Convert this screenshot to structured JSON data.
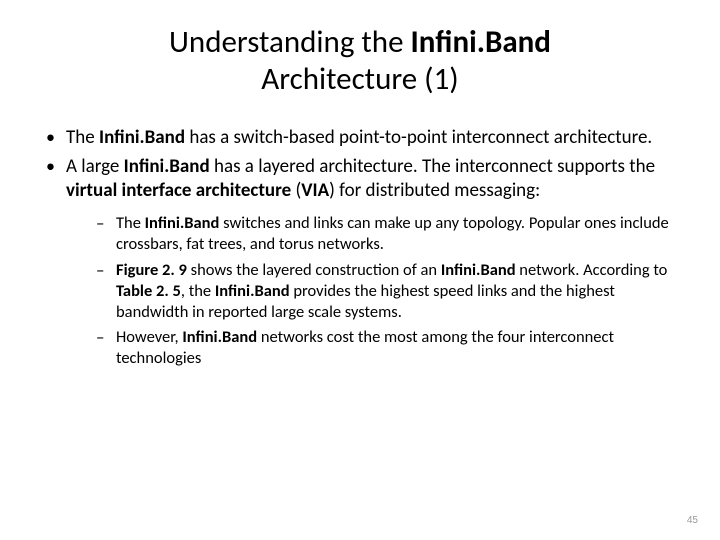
{
  "title": {
    "prefix": "Understanding the ",
    "bold": "Infini.Band",
    "line2": "Architecture (1)"
  },
  "bullets": {
    "b1": {
      "p1": "The ",
      "p2": "Infini.Band ",
      "p3": "has a switch-based point-to-point interconnect architecture."
    },
    "b2": {
      "p1": "A large ",
      "p2": "Infini.Band ",
      "p3": "has a layered architecture.  The interconnect supports the ",
      "p4": "virtual interface architecture ",
      "p5": "(",
      "p6": "VIA",
      "p7": ") for distributed messaging:"
    }
  },
  "subs": {
    "s1": {
      "p1": "The ",
      "p2": "Infini.Band ",
      "p3": "switches and links can make up any topology. Popular ones include crossbars, fat trees, and torus networks."
    },
    "s2": {
      "p1": "Figure 2. 9 ",
      "p2": "shows the layered construction of an ",
      "p3": "Infini.Band ",
      "p4": "network. According to ",
      "p5": "Table 2. 5",
      "p6": ", the ",
      "p7": "Infini.Band ",
      "p8": "provides the highest speed links and the highest bandwidth in reported large scale systems."
    },
    "s3": {
      "p1": "However, ",
      "p2": "Infini.Band ",
      "p3": "networks cost the most among the four interconnect technologies"
    }
  },
  "pagenum": "45"
}
